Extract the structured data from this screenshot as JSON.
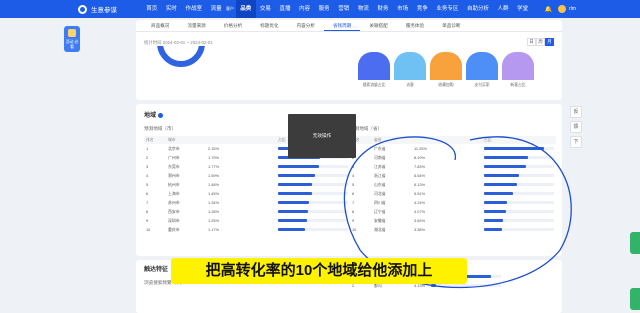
{
  "nav": {
    "brand": "生意参谋",
    "items": [
      "首页",
      "实时",
      "作战室",
      "流量",
      "品类",
      "交易",
      "直播",
      "内容",
      "服务",
      "营销",
      "物流",
      "财务",
      "市场",
      "竞争",
      "业务专区",
      "自助分析",
      "人群",
      "学堂"
    ],
    "active_index": 4,
    "extra_badge": "客户",
    "username": "rlm"
  },
  "left_badge": "活动 必看",
  "tabs": {
    "items": [
      "商品概况",
      "流量来源",
      "价格分析",
      "标题优化",
      "内容分析",
      "省钱周期",
      "关联搭配",
      "服务体验",
      "单品诊断"
    ],
    "active_index": 5
  },
  "date_range": "统计时间 2024-02-01 ~ 2024-02-01",
  "period_buttons": [
    "日",
    "周",
    "月"
  ],
  "funnel_labels": [
    "搜索流量占比",
    "访客",
    "收藏加购",
    "支付买家",
    "新客占比"
  ],
  "funnel_colors": [
    "#4d6df0",
    "#6ec1f2",
    "#f7a23c",
    "#4d8ef7",
    "#b698f0"
  ],
  "region": {
    "title": "地域",
    "left_subtitle": "预测地域（市）",
    "right_subtitle": "预测地域（省）",
    "left_headers": [
      "排名",
      "城市",
      "",
      "占比"
    ],
    "right_headers": [
      "排名",
      "省份",
      "",
      "占比"
    ],
    "cities": [
      {
        "rank": "1",
        "name": "北京市",
        "pct": "2.15%",
        "value": 2.15
      },
      {
        "rank": "2",
        "name": "广州市",
        "pct": "1.79%",
        "value": 1.79
      },
      {
        "rank": "3",
        "name": "东莞市",
        "pct": "1.77%",
        "value": 1.77
      },
      {
        "rank": "4",
        "name": "郑州市",
        "pct": "1.59%",
        "value": 1.59
      },
      {
        "rank": "5",
        "name": "杭州市",
        "pct": "1.48%",
        "value": 1.48
      },
      {
        "rank": "6",
        "name": "上海市",
        "pct": "1.45%",
        "value": 1.45
      },
      {
        "rank": "7",
        "name": "苏州市",
        "pct": "1.34%",
        "value": 1.34
      },
      {
        "rank": "8",
        "name": "西安市",
        "pct": "1.28%",
        "value": 1.28
      },
      {
        "rank": "9",
        "name": "深圳市",
        "pct": "1.25%",
        "value": 1.25
      },
      {
        "rank": "10",
        "name": "重庆市",
        "pct": "1.17%",
        "value": 1.17
      }
    ],
    "provinces": [
      {
        "rank": "1",
        "name": "广东省",
        "pct": "11.25%",
        "value": 11.25
      },
      {
        "rank": "2",
        "name": "河南省",
        "pct": "8.19%",
        "value": 8.19
      },
      {
        "rank": "3",
        "name": "江苏省",
        "pct": "7.83%",
        "value": 7.83
      },
      {
        "rank": "4",
        "name": "浙江省",
        "pct": "6.64%",
        "value": 6.64
      },
      {
        "rank": "5",
        "name": "山东省",
        "pct": "6.13%",
        "value": 6.13
      },
      {
        "rank": "6",
        "name": "河北省",
        "pct": "5.51%",
        "value": 5.51
      },
      {
        "rank": "7",
        "name": "四川省",
        "pct": "4.24%",
        "value": 4.24
      },
      {
        "rank": "8",
        "name": "辽宁省",
        "pct": "4.07%",
        "value": 4.07
      },
      {
        "rank": "9",
        "name": "安徽省",
        "pct": "3.64%",
        "value": 3.64
      },
      {
        "rank": "10",
        "name": "湖北省",
        "pct": "3.38%",
        "value": 3.38
      }
    ]
  },
  "overlay_text": "无效操作",
  "overlay_close": "×",
  "feature": {
    "title": "触达特征",
    "subtitle": "浏览搜索频繁（次）",
    "rows": [
      {
        "rank": "1",
        "name": "单之类",
        "pct": "47.72%",
        "value": 47.72
      },
      {
        "rank": "2",
        "name": "都司",
        "pct": "4.13%",
        "value": 4.13
      }
    ]
  },
  "side_buttons": [
    "反",
    "馈",
    "下"
  ],
  "caption": "把高转化率的10个地域给他添加上"
}
